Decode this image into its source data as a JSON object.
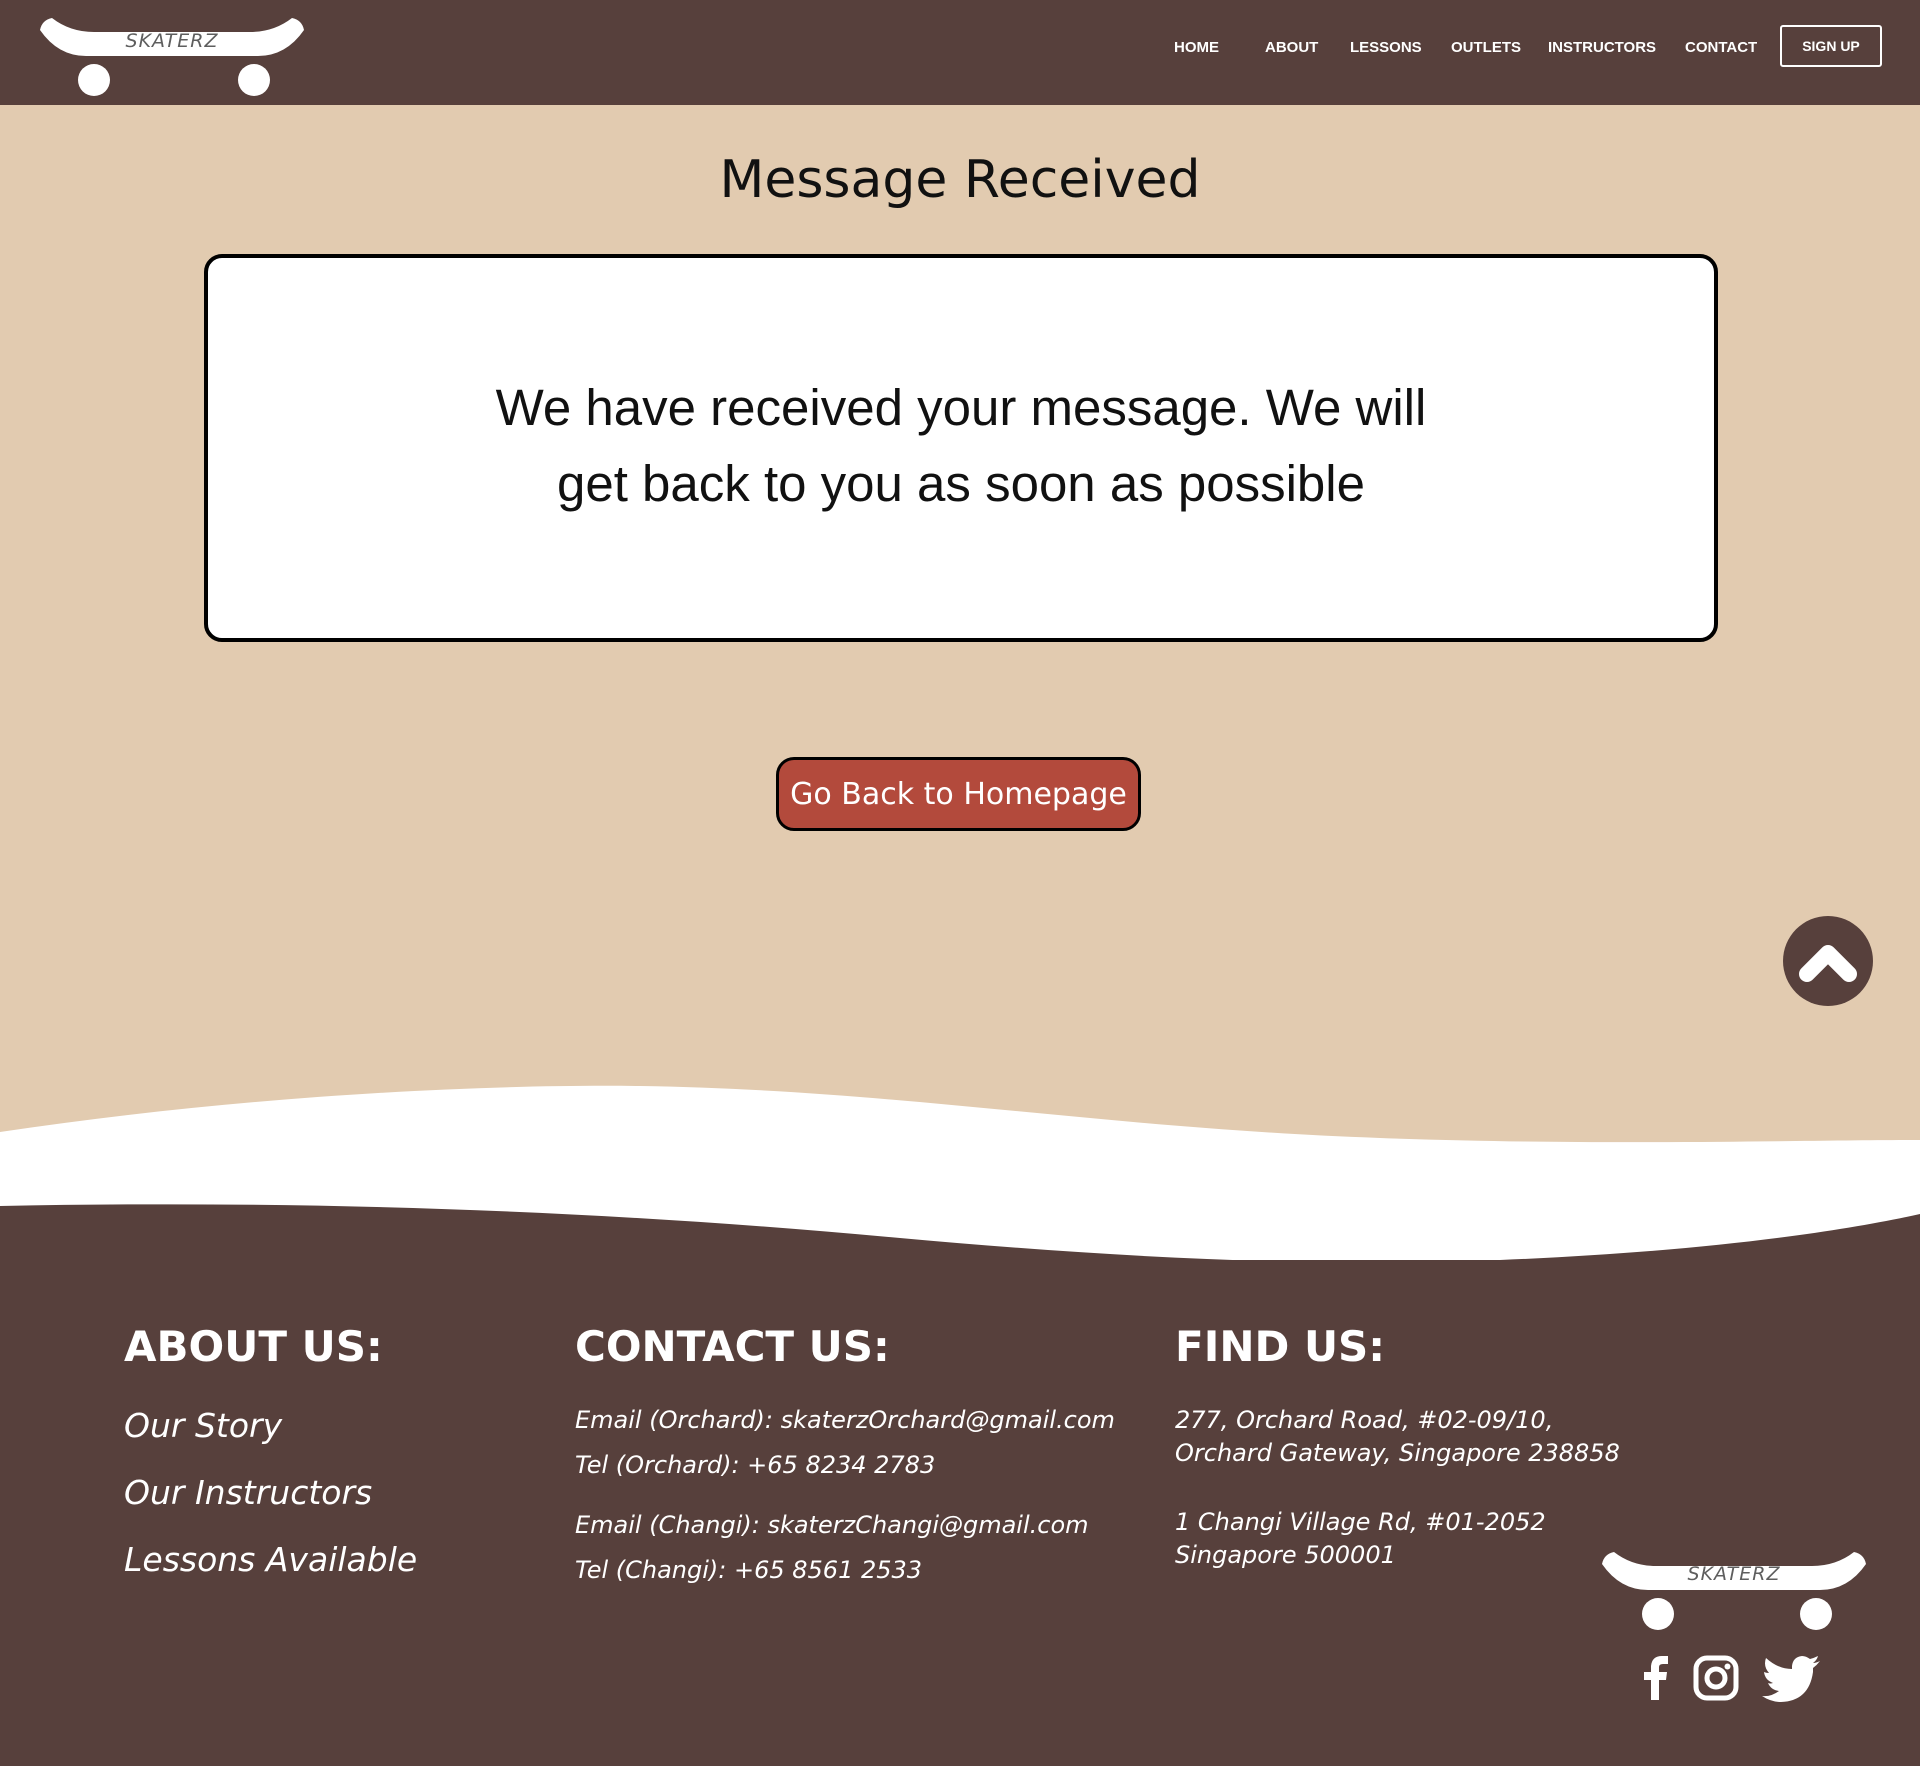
{
  "colors": {
    "brand_brown": "#57403c",
    "page_beige": "#e2cbb0",
    "accent_red": "#b34a3c",
    "white": "#ffffff"
  },
  "header": {
    "logo_text": "SKATERZ",
    "nav": [
      "HOME",
      "ABOUT",
      "LESSONS",
      "OUTLETS",
      "INSTRUCTORS",
      "CONTACT"
    ],
    "signup_label": "SIGN UP"
  },
  "main": {
    "title": "Message Received",
    "message_line1": "We have received your message. We will",
    "message_line2": "get back to you as soon as possible",
    "home_button": "Go Back to Homepage",
    "scroll_top_icon": "chevron-up-icon"
  },
  "footer": {
    "about": {
      "heading": "ABOUT US:",
      "links": [
        "Our Story",
        "Our Instructors",
        "Lessons Available"
      ]
    },
    "contact": {
      "heading": "CONTACT US:",
      "email_orchard": "Email (Orchard): skaterzOrchard@gmail.com",
      "tel_orchard": "Tel (Orchard):  +65 8234 2783",
      "email_changi": "Email (Changi): skaterzChangi@gmail.com",
      "tel_changi": "Tel (Changi):  +65 8561 2533"
    },
    "find": {
      "heading": "FIND US:",
      "orchard_line1": "277, Orchard Road, #02-09/10,",
      "orchard_line2": "Orchard Gateway, Singapore 238858",
      "changi_line1": "1 Changi Village Rd, #01-2052",
      "changi_line2": "Singapore 500001"
    },
    "logo_text": "SKATERZ",
    "social_icons": [
      "facebook-icon",
      "instagram-icon",
      "twitter-icon"
    ]
  }
}
